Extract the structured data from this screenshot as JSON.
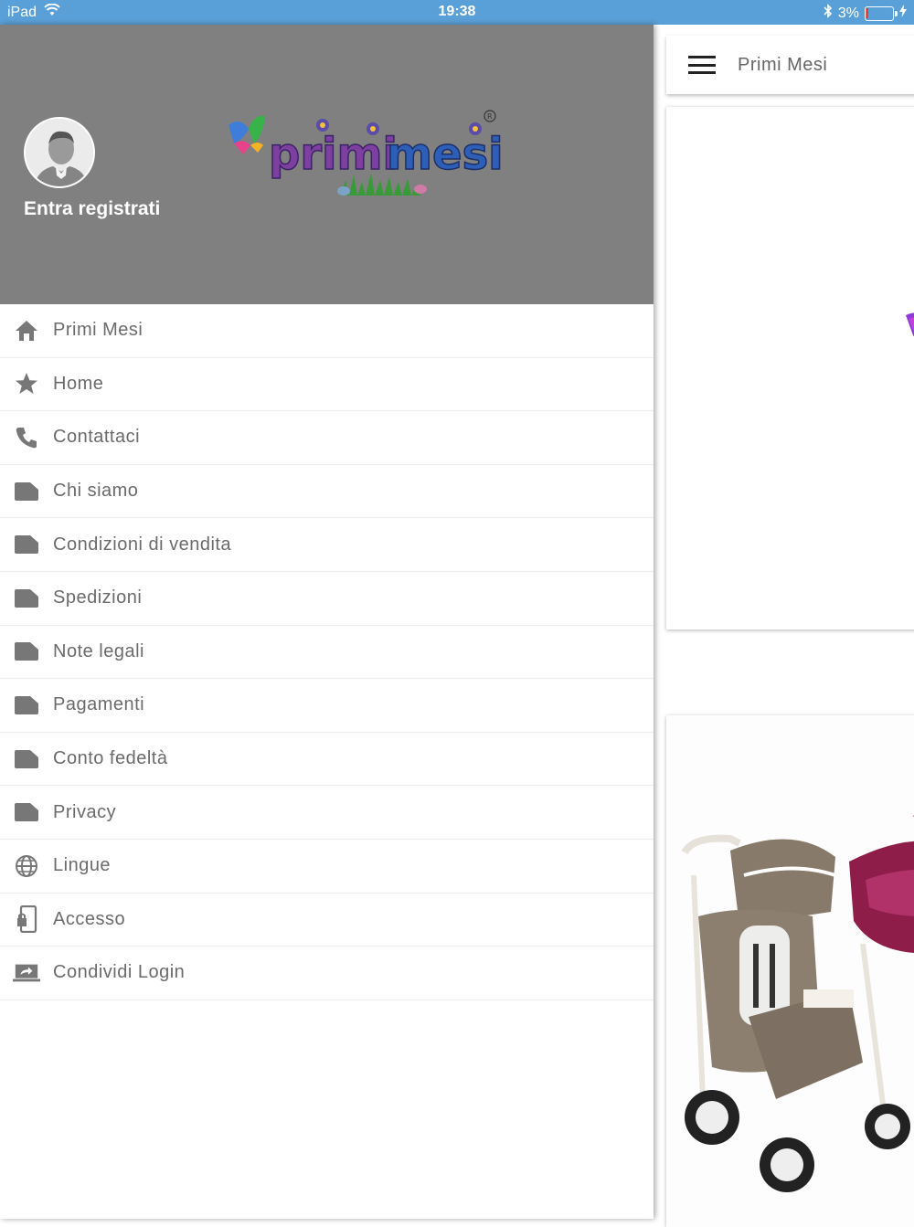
{
  "status_bar": {
    "device": "iPad",
    "time": "19:38",
    "battery": "3%"
  },
  "main": {
    "app_bar_title": "Primi Mesi"
  },
  "drawer": {
    "login_label": "Entra registrati",
    "logo_text": "primi mesi",
    "menu_items": [
      {
        "label": "Primi Mesi",
        "icon": "home-icon"
      },
      {
        "label": "Home",
        "icon": "star-icon"
      },
      {
        "label": "Contattaci",
        "icon": "phone-icon"
      },
      {
        "label": "Chi siamo",
        "icon": "folder-icon"
      },
      {
        "label": "Condizioni di vendita",
        "icon": "folder-icon"
      },
      {
        "label": "Spedizioni",
        "icon": "folder-icon"
      },
      {
        "label": "Note legali",
        "icon": "folder-icon"
      },
      {
        "label": "Pagamenti",
        "icon": "folder-icon"
      },
      {
        "label": "Conto fedeltà",
        "icon": "folder-icon"
      },
      {
        "label": "Privacy",
        "icon": "folder-icon"
      },
      {
        "label": "Lingue",
        "icon": "globe-icon"
      },
      {
        "label": "Accesso",
        "icon": "phone-lock-icon"
      },
      {
        "label": "Condividi Login",
        "icon": "share-laptop-icon"
      }
    ]
  },
  "colors": {
    "status_bar": "#5aa0d8",
    "drawer_header": "#808080",
    "menu_text": "#6b6b6b"
  }
}
